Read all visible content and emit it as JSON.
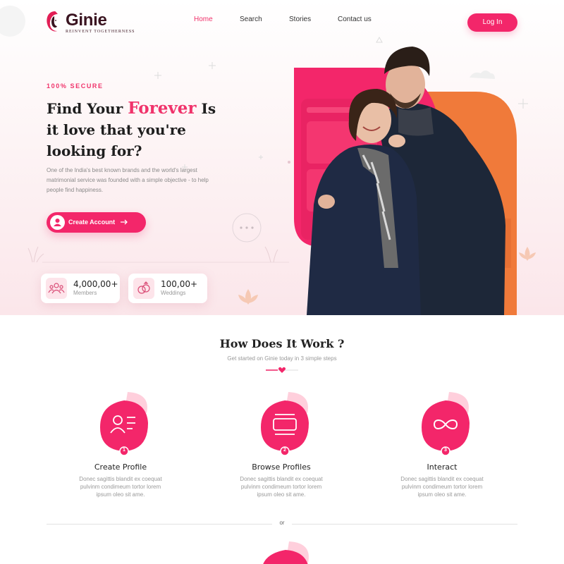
{
  "brand": {
    "name": "Ginie",
    "tagline": "REINVENT TOGETHERNESS"
  },
  "nav": {
    "items": [
      "Home",
      "Search",
      "Stories",
      "Contact us"
    ],
    "active": "Home"
  },
  "header": {
    "login_label": "Log In"
  },
  "hero": {
    "eyebrow": "100% SECURE",
    "headline_pre": "Find Your ",
    "headline_accent": "Forever",
    "headline_post": " Is it love that you're looking for?",
    "description": "One of the India's best known brands and the world's largest matrimonial service was founded with a simple objective - to help people find happiness.",
    "cta_label": "Create Account",
    "stats": [
      {
        "value": "4,000,00+",
        "label": "Members",
        "icon": "members-icon"
      },
      {
        "value": "100,00+",
        "label": "Weddings",
        "icon": "rings-icon"
      }
    ]
  },
  "how": {
    "title": "How Does It Work ?",
    "subtitle": "Get started on Ginie today in 3 simple steps",
    "steps": [
      {
        "number": "1",
        "title": "Create Profile",
        "description": "Donec sagittis blandit ex coequat pulvinm condimeum tortor lorem ipsum oleo sit ame.",
        "icon": "profile-card-icon"
      },
      {
        "number": "2",
        "title": "Browse Profiles",
        "description": "Donec sagittis blandit ex coequat pulvinm condimeum tortor lorem ipsum oleo sit ame.",
        "icon": "browse-cards-icon"
      },
      {
        "number": "3",
        "title": "Interact",
        "description": "Donec sagittis blandit ex coequat pulvinm condimeum tortor lorem ipsum oleo sit ame.",
        "icon": "infinity-icon"
      }
    ],
    "or_label": "or"
  },
  "colors": {
    "accent": "#f3266a",
    "accent_text": "#f0336b",
    "heading": "#1e1e1e",
    "muted": "#999999",
    "orange": "#f07a3a",
    "hero_bg": "#fbe6ea"
  }
}
